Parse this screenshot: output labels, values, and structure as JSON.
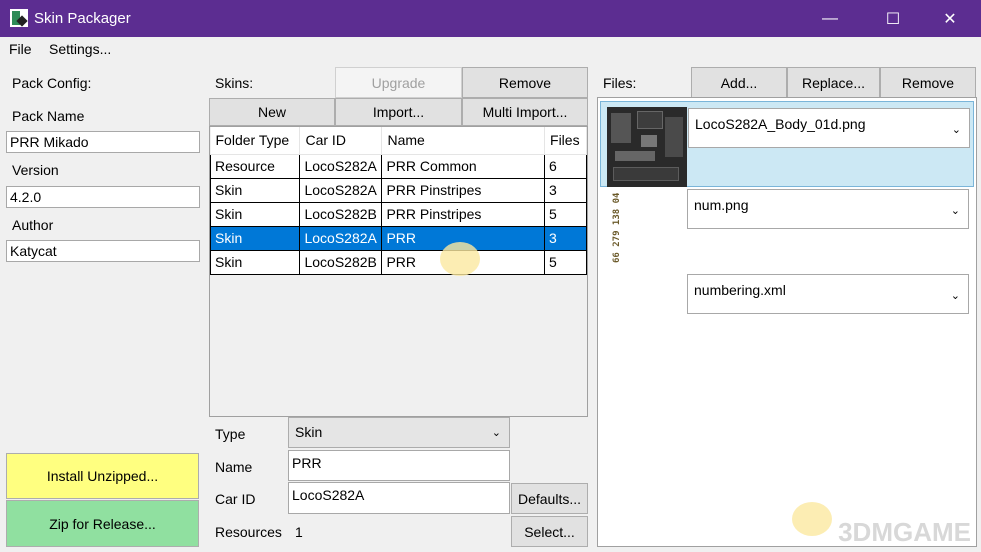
{
  "window": {
    "title": "Skin Packager",
    "controls": {
      "minimize": "—",
      "maximize": "☐",
      "close": "✕"
    }
  },
  "menu": [
    "File",
    "Settings..."
  ],
  "pack_config": {
    "heading": "Pack Config:",
    "pack_name_label": "Pack Name",
    "pack_name_value": "PRR Mikado",
    "version_label": "Version",
    "version_value": "4.2.0",
    "author_label": "Author",
    "author_value": "Katycat",
    "install_label": "Install Unzipped...",
    "zip_label": "Zip for Release..."
  },
  "skins": {
    "heading": "Skins:",
    "upgrade_label": "Upgrade",
    "remove_label": "Remove",
    "new_label": "New",
    "import_label": "Import...",
    "multi_import_label": "Multi Import...",
    "columns": [
      "Folder Type",
      "Car ID",
      "Name",
      "Files"
    ],
    "rows": [
      [
        "Resource",
        "LocoS282A",
        "PRR Common",
        "6"
      ],
      [
        "Skin",
        "LocoS282A",
        "PRR Pinstripes",
        "3"
      ],
      [
        "Skin",
        "LocoS282B",
        "PRR Pinstripes",
        "5"
      ],
      [
        "Skin",
        "LocoS282A",
        "PRR",
        "3"
      ],
      [
        "Skin",
        "LocoS282B",
        "PRR",
        "5"
      ]
    ],
    "selected_row": 3
  },
  "details": {
    "type_label": "Type",
    "type_value": "Skin",
    "name_label": "Name",
    "name_value": "PRR",
    "carid_label": "Car ID",
    "carid_value": "LocoS282A",
    "defaults_label": "Defaults...",
    "resources_label": "Resources",
    "resources_value": "1",
    "select_label": "Select..."
  },
  "files": {
    "heading": "Files:",
    "add_label": "Add...",
    "replace_label": "Replace...",
    "remove_label": "Remove",
    "items": [
      {
        "name": "LocoS282A_Body_01d.png",
        "selected": true
      },
      {
        "name": "num.png",
        "selected": false,
        "preview_text": "66 279 138 04"
      },
      {
        "name": "numbering.xml",
        "selected": false
      }
    ]
  },
  "watermark": "3DMGAME",
  "colors": {
    "titlebar": "#5c2d91",
    "selection": "#0078d7",
    "install": "#ffff80",
    "zip": "#90e0a0",
    "file_selected": "#cce8f4"
  }
}
